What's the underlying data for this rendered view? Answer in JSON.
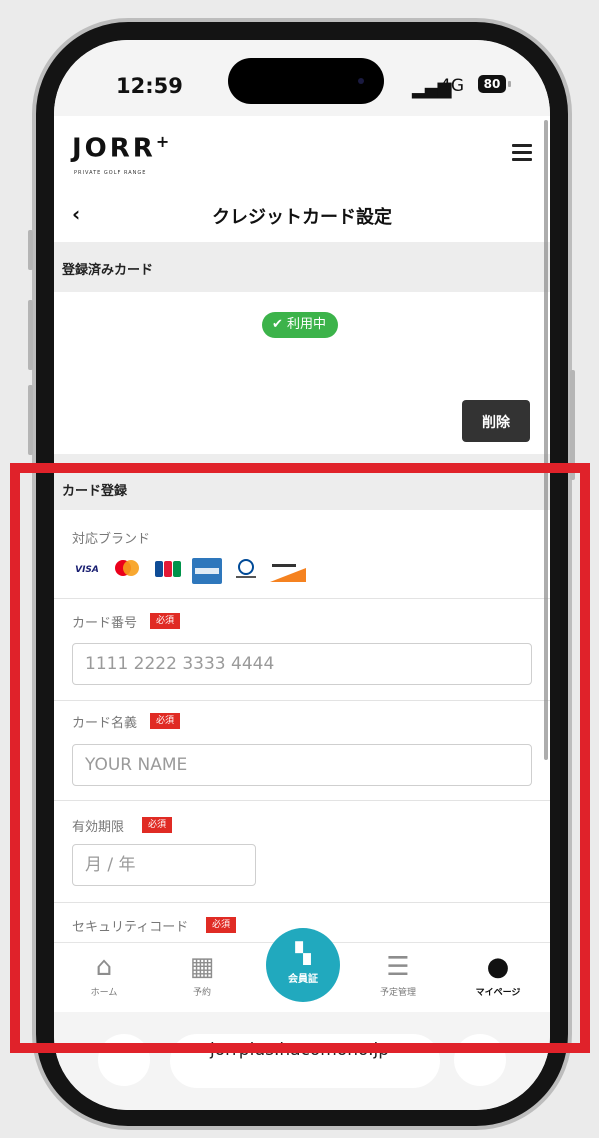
{
  "status_bar": {
    "time": "12:59",
    "signal_label": "•ıl",
    "network": "4G",
    "battery": "80"
  },
  "app_header": {
    "logo": "JORR",
    "logo_plus": "+",
    "logo_sub": "PRIVATE GOLF RANGE",
    "menu_icon": "hamburger-menu-icon"
  },
  "title_bar": {
    "back_icon": "‹",
    "title": "クレジットカード設定"
  },
  "registered_section": {
    "header": "登録済みカード",
    "status_badge": "✔ 利用中",
    "delete_button": "削除"
  },
  "register_section": {
    "header": "カード登録",
    "brands_label": "対応ブランド",
    "brands": [
      "VISA",
      "Mastercard",
      "JCB",
      "AMEX",
      "Diners Club",
      "DISCOVER"
    ],
    "card_number": {
      "label": "カード番号",
      "required": "必須",
      "placeholder": "1111 2222 3333 4444"
    },
    "card_name": {
      "label": "カード名義",
      "required": "必須",
      "placeholder": "YOUR NAME"
    },
    "expiry": {
      "label": "有効期限",
      "required": "必須",
      "placeholder": "月 / 年"
    },
    "security_code": {
      "label": "セキュリティコード",
      "required": "必須"
    }
  },
  "tab_bar": {
    "home": "ホーム",
    "reserve": "予約",
    "member_card": "会員証",
    "schedule": "予定管理",
    "mypage": "マイページ"
  },
  "browser": {
    "url": "jorrplus.hacomono.jp"
  },
  "colors": {
    "accent": "#21a9be",
    "required_red": "#e02b24",
    "active_green": "#3cb34a",
    "highlight_red": "#e0222a"
  }
}
